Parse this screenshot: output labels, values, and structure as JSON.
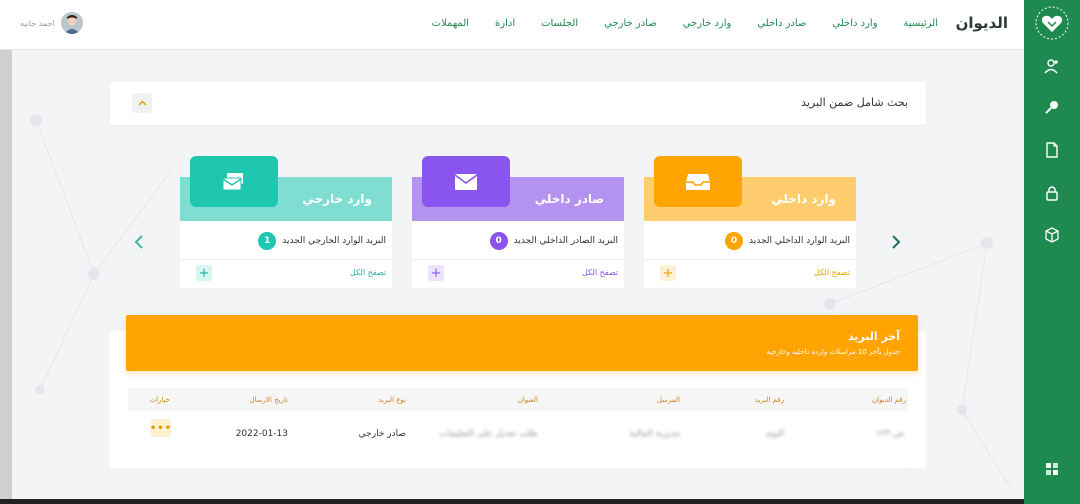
{
  "app": {
    "brand": "الديوان",
    "user_name": "احمد جانيه"
  },
  "nav": {
    "items": [
      "الرئيسية",
      "وارد داخلي",
      "صادر داخلي",
      "وارد خارجي",
      "صادر خارجي",
      "الجلسات",
      "ادارة",
      "المهملات"
    ]
  },
  "colors": {
    "sidebar": "#1e8a4f",
    "nav_text": "#1e8a4f",
    "banner": "#ffa400",
    "card_incoming_internal": "#ffcd6e",
    "card_outgoing_internal": "#b392f0",
    "card_incoming_external": "#7fded1"
  },
  "sidebar": {
    "icons": [
      "logo-heart-icon",
      "user-add-icon",
      "search-key-icon",
      "file-icon",
      "lock-icon",
      "cube-icon",
      "grid-icon"
    ]
  },
  "search": {
    "title": "بحث شامل ضمن البريد"
  },
  "cards": [
    {
      "label": "وارد داخلي",
      "description": "البريد الوارد الداخلي الجديد",
      "count": "0",
      "view_all": "تصفح الكل",
      "plus": "+",
      "icon": "inbox-tray-icon"
    },
    {
      "label": "صادر داخلي",
      "description": "البريد الصادر الداخلي الجديد",
      "count": "0",
      "view_all": "تصفح الكل",
      "plus": "+",
      "icon": "envelope-icon"
    },
    {
      "label": "وارد خارجي",
      "description": "البريد الوارد الخارجي الجديد",
      "count": "1",
      "view_all": "تصفح الكل",
      "plus": "+",
      "icon": "envelopes-icon"
    }
  ],
  "mail": {
    "title": "آخر البريد",
    "subtitle": "جدول بآخر 10 مراسلات واردة داخلية وخارجية",
    "columns": [
      "رقم الديوان",
      "رقم البريد",
      "المرسل",
      "العنوان",
      "نوع البريد",
      "تاريخ الارسال",
      "خيارات"
    ],
    "rows": [
      {
        "diwan_no": "ص-١٢٣",
        "mail_no": "البوم",
        "sender": "مديرية المالية",
        "subject": "طلب تعديل على التعليمات",
        "type": "صادر خارجي",
        "date": "2022-01-13",
        "options": "•••"
      }
    ]
  }
}
